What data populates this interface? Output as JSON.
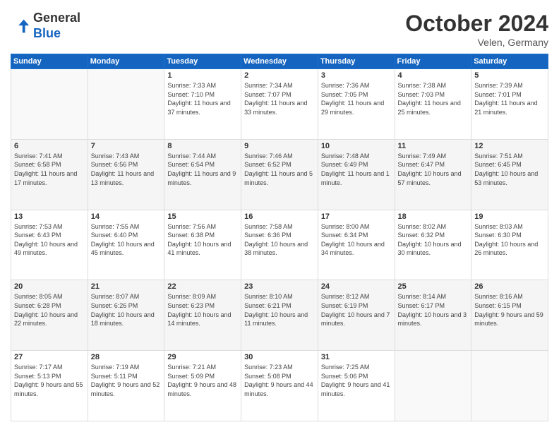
{
  "header": {
    "logo_line1": "General",
    "logo_line2": "Blue",
    "month": "October 2024",
    "location": "Velen, Germany"
  },
  "days_of_week": [
    "Sunday",
    "Monday",
    "Tuesday",
    "Wednesday",
    "Thursday",
    "Friday",
    "Saturday"
  ],
  "weeks": [
    [
      {
        "day": "",
        "info": ""
      },
      {
        "day": "",
        "info": ""
      },
      {
        "day": "1",
        "info": "Sunrise: 7:33 AM\nSunset: 7:10 PM\nDaylight: 11 hours and 37 minutes."
      },
      {
        "day": "2",
        "info": "Sunrise: 7:34 AM\nSunset: 7:07 PM\nDaylight: 11 hours and 33 minutes."
      },
      {
        "day": "3",
        "info": "Sunrise: 7:36 AM\nSunset: 7:05 PM\nDaylight: 11 hours and 29 minutes."
      },
      {
        "day": "4",
        "info": "Sunrise: 7:38 AM\nSunset: 7:03 PM\nDaylight: 11 hours and 25 minutes."
      },
      {
        "day": "5",
        "info": "Sunrise: 7:39 AM\nSunset: 7:01 PM\nDaylight: 11 hours and 21 minutes."
      }
    ],
    [
      {
        "day": "6",
        "info": "Sunrise: 7:41 AM\nSunset: 6:58 PM\nDaylight: 11 hours and 17 minutes."
      },
      {
        "day": "7",
        "info": "Sunrise: 7:43 AM\nSunset: 6:56 PM\nDaylight: 11 hours and 13 minutes."
      },
      {
        "day": "8",
        "info": "Sunrise: 7:44 AM\nSunset: 6:54 PM\nDaylight: 11 hours and 9 minutes."
      },
      {
        "day": "9",
        "info": "Sunrise: 7:46 AM\nSunset: 6:52 PM\nDaylight: 11 hours and 5 minutes."
      },
      {
        "day": "10",
        "info": "Sunrise: 7:48 AM\nSunset: 6:49 PM\nDaylight: 11 hours and 1 minute."
      },
      {
        "day": "11",
        "info": "Sunrise: 7:49 AM\nSunset: 6:47 PM\nDaylight: 10 hours and 57 minutes."
      },
      {
        "day": "12",
        "info": "Sunrise: 7:51 AM\nSunset: 6:45 PM\nDaylight: 10 hours and 53 minutes."
      }
    ],
    [
      {
        "day": "13",
        "info": "Sunrise: 7:53 AM\nSunset: 6:43 PM\nDaylight: 10 hours and 49 minutes."
      },
      {
        "day": "14",
        "info": "Sunrise: 7:55 AM\nSunset: 6:40 PM\nDaylight: 10 hours and 45 minutes."
      },
      {
        "day": "15",
        "info": "Sunrise: 7:56 AM\nSunset: 6:38 PM\nDaylight: 10 hours and 41 minutes."
      },
      {
        "day": "16",
        "info": "Sunrise: 7:58 AM\nSunset: 6:36 PM\nDaylight: 10 hours and 38 minutes."
      },
      {
        "day": "17",
        "info": "Sunrise: 8:00 AM\nSunset: 6:34 PM\nDaylight: 10 hours and 34 minutes."
      },
      {
        "day": "18",
        "info": "Sunrise: 8:02 AM\nSunset: 6:32 PM\nDaylight: 10 hours and 30 minutes."
      },
      {
        "day": "19",
        "info": "Sunrise: 8:03 AM\nSunset: 6:30 PM\nDaylight: 10 hours and 26 minutes."
      }
    ],
    [
      {
        "day": "20",
        "info": "Sunrise: 8:05 AM\nSunset: 6:28 PM\nDaylight: 10 hours and 22 minutes."
      },
      {
        "day": "21",
        "info": "Sunrise: 8:07 AM\nSunset: 6:26 PM\nDaylight: 10 hours and 18 minutes."
      },
      {
        "day": "22",
        "info": "Sunrise: 8:09 AM\nSunset: 6:23 PM\nDaylight: 10 hours and 14 minutes."
      },
      {
        "day": "23",
        "info": "Sunrise: 8:10 AM\nSunset: 6:21 PM\nDaylight: 10 hours and 11 minutes."
      },
      {
        "day": "24",
        "info": "Sunrise: 8:12 AM\nSunset: 6:19 PM\nDaylight: 10 hours and 7 minutes."
      },
      {
        "day": "25",
        "info": "Sunrise: 8:14 AM\nSunset: 6:17 PM\nDaylight: 10 hours and 3 minutes."
      },
      {
        "day": "26",
        "info": "Sunrise: 8:16 AM\nSunset: 6:15 PM\nDaylight: 9 hours and 59 minutes."
      }
    ],
    [
      {
        "day": "27",
        "info": "Sunrise: 7:17 AM\nSunset: 5:13 PM\nDaylight: 9 hours and 55 minutes."
      },
      {
        "day": "28",
        "info": "Sunrise: 7:19 AM\nSunset: 5:11 PM\nDaylight: 9 hours and 52 minutes."
      },
      {
        "day": "29",
        "info": "Sunrise: 7:21 AM\nSunset: 5:09 PM\nDaylight: 9 hours and 48 minutes."
      },
      {
        "day": "30",
        "info": "Sunrise: 7:23 AM\nSunset: 5:08 PM\nDaylight: 9 hours and 44 minutes."
      },
      {
        "day": "31",
        "info": "Sunrise: 7:25 AM\nSunset: 5:06 PM\nDaylight: 9 hours and 41 minutes."
      },
      {
        "day": "",
        "info": ""
      },
      {
        "day": "",
        "info": ""
      }
    ]
  ]
}
